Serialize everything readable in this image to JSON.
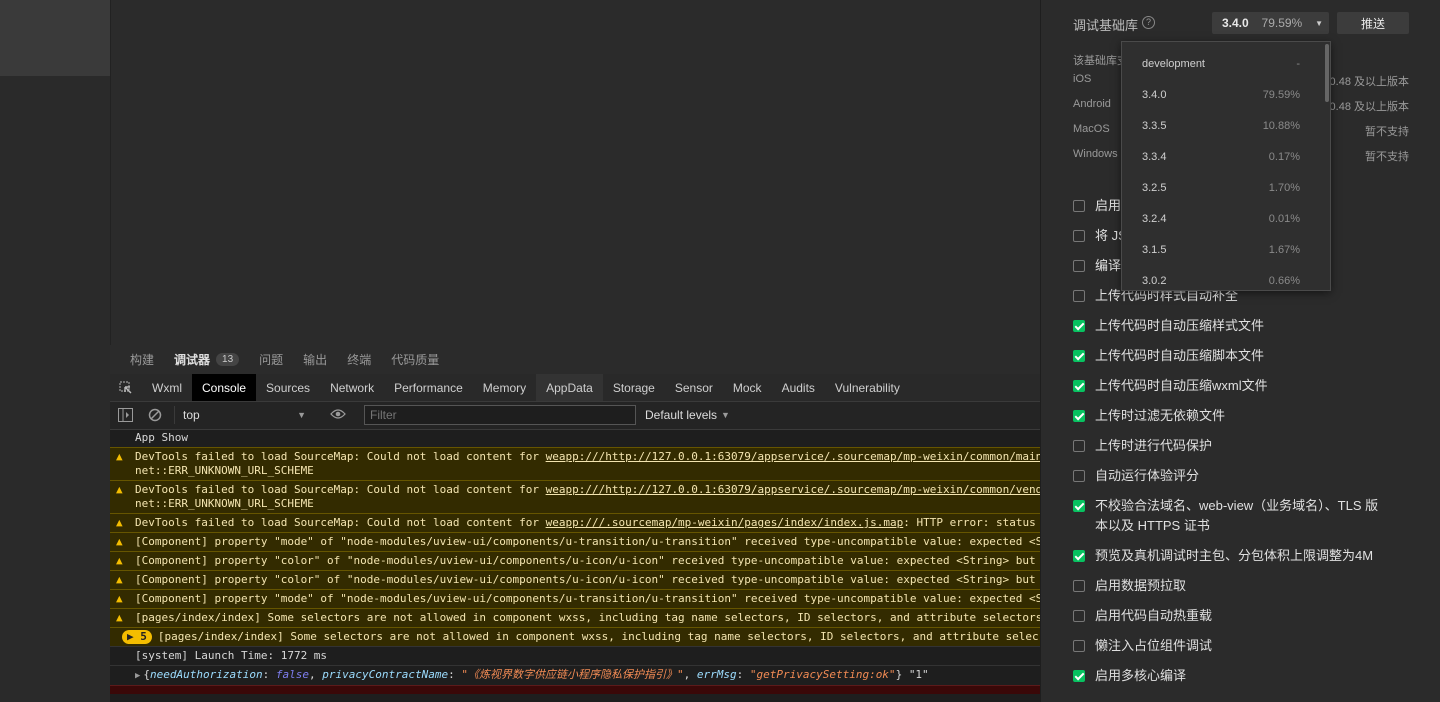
{
  "bottom_tabs": [
    {
      "label": "构建"
    },
    {
      "label": "调试器",
      "badge": "13"
    },
    {
      "label": "问题"
    },
    {
      "label": "输出"
    },
    {
      "label": "终端"
    },
    {
      "label": "代码质量"
    }
  ],
  "devtools_tabs": [
    "Wxml",
    "Console",
    "Sources",
    "Network",
    "Performance",
    "Memory",
    "AppData",
    "Storage",
    "Sensor",
    "Mock",
    "Audits",
    "Vulnerability"
  ],
  "toolbar": {
    "context": "top",
    "filter_placeholder": "Filter",
    "levels": "Default levels"
  },
  "logs": {
    "app_show": "App Show",
    "w1": "DevTools failed to load SourceMap: Could not load content for ",
    "w1_link": "weapp:///http://127.0.0.1:63079/appservice/.sourcemap/mp-weixin/common/main.",
    "w1_b": "net::ERR_UNKNOWN_URL_SCHEME",
    "w2": "DevTools failed to load SourceMap: Could not load content for ",
    "w2_link": "weapp:///http://127.0.0.1:63079/appservice/.sourcemap/mp-weixin/common/vendo",
    "w2_b": "net::ERR_UNKNOWN_URL_SCHEME",
    "w3": "DevTools failed to load SourceMap: Could not load content for ",
    "w3_link": "weapp:///.sourcemap/mp-weixin/pages/index/index.js.map",
    "w3_tail": ": HTTP error: status",
    "w4": "[Component] property \"mode\" of \"node-modules/uview-ui/components/u-transition/u-transition\" received type-uncompatible value: expected <S",
    "w5": "[Component] property \"color\" of \"node-modules/uview-ui/components/u-icon/u-icon\" received type-uncompatible value: expected <String> but",
    "w6": "[Component] property \"color\" of \"node-modules/uview-ui/components/u-icon/u-icon\" received type-uncompatible value: expected <String> but",
    "w7": "[Component] property \"mode\" of \"node-modules/uview-ui/components/u-transition/u-transition\" received type-uncompatible value: expected <S",
    "w8": "[pages/index/index] Some selectors are not allowed in component wxss, including tag name selectors, ID selectors, and attribute selectors",
    "w9_count": "5",
    "w9": "[pages/index/index] Some selectors are not allowed in component wxss, including tag name selectors, ID selectors, and attribute selec",
    "launch": "[system] Launch Time: 1772 ms",
    "obj_k1": "needAuthorization",
    "obj_v1": "false",
    "obj_k2": "privacyContractName",
    "obj_v2": "\"《炼视界数字供应链小程序隐私保护指引》\"",
    "obj_k3": "errMsg",
    "obj_v3": "\"getPrivacySetting:ok\"",
    "obj_tail": "\"1\""
  },
  "settings": {
    "base_lib_label": "调试基础库",
    "version": "3.4.0",
    "version_pct": "79.59%",
    "push_label": "推送",
    "note": "该基础库支",
    "platforms": [
      {
        "name": "iOS",
        "value": "0.48 及以上版本"
      },
      {
        "name": "Android",
        "value": "0.48 及以上版本"
      },
      {
        "name": "MacOS",
        "value": "暂不支持"
      },
      {
        "name": "Windows",
        "value": "暂不支持"
      }
    ],
    "checks": [
      {
        "label": "启用",
        "on": false
      },
      {
        "label": "将 JS",
        "on": false
      },
      {
        "label": "编译",
        "on": false
      },
      {
        "label": "上传代码时样式自动补全",
        "on": false
      },
      {
        "label": "上传代码时自动压缩样式文件",
        "on": true
      },
      {
        "label": "上传代码时自动压缩脚本文件",
        "on": true
      },
      {
        "label": "上传代码时自动压缩wxml文件",
        "on": true
      },
      {
        "label": "上传时过滤无依赖文件",
        "on": true
      },
      {
        "label": "上传时进行代码保护",
        "on": false
      },
      {
        "label": "自动运行体验评分",
        "on": false
      },
      {
        "label": "不校验合法域名、web-view（业务域名）、TLS 版",
        "label2": "本以及 HTTPS 证书",
        "on": true
      },
      {
        "label": "预览及真机调试时主包、分包体积上限调整为4M",
        "on": true
      },
      {
        "label": "启用数据预拉取",
        "on": false
      },
      {
        "label": "启用代码自动热重载",
        "on": false
      },
      {
        "label": "懒注入占位组件调试",
        "on": false
      },
      {
        "label": "启用多核心编译",
        "on": true
      }
    ]
  },
  "dropdown": [
    {
      "v": "development",
      "p": "-"
    },
    {
      "v": "3.4.0",
      "p": "79.59%"
    },
    {
      "v": "3.3.5",
      "p": "10.88%"
    },
    {
      "v": "3.3.4",
      "p": "0.17%"
    },
    {
      "v": "3.2.5",
      "p": "1.70%"
    },
    {
      "v": "3.2.4",
      "p": "0.01%"
    },
    {
      "v": "3.1.5",
      "p": "1.67%"
    },
    {
      "v": "3.0.2",
      "p": "0.66%"
    }
  ],
  "colors": {
    "accent_green": "#07c160",
    "warning_yellow": "#f4bd00",
    "warning_bg": "#332b00"
  }
}
